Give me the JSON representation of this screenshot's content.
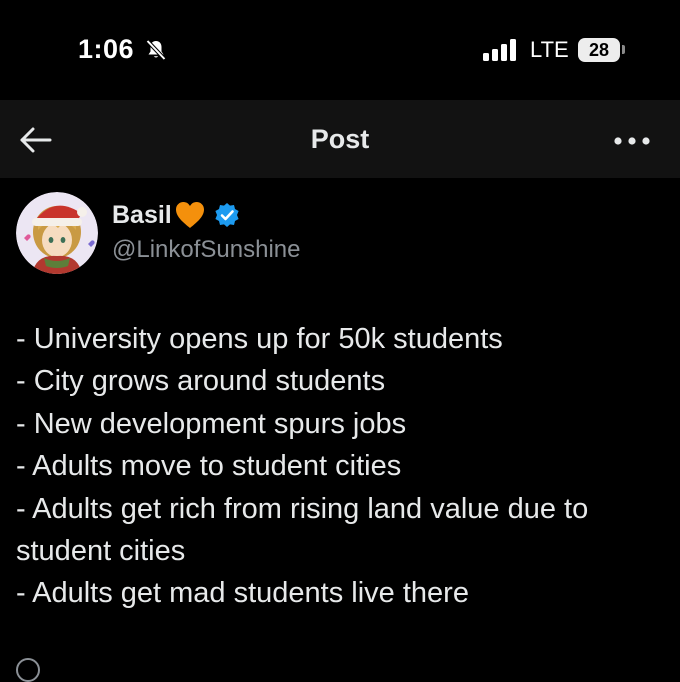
{
  "status_bar": {
    "time": "1:06",
    "network": "LTE",
    "battery": "28"
  },
  "nav": {
    "title": "Post"
  },
  "post": {
    "author_name": "Basil",
    "author_handle": "@LinkofSunshine",
    "lines": [
      "- University opens up for 50k students",
      "- City grows around students",
      "- New development spurs jobs",
      "- Adults move to student cities",
      "- Adults get rich from rising land value due to student cities",
      "- Adults get mad students live there"
    ]
  },
  "colors": {
    "background": "#000000",
    "nav_background": "#121212",
    "text": "#e7e9ea",
    "secondary_text": "#8b9096",
    "verified_blue": "#1d9bf0",
    "heart_orange": "#f4900c"
  },
  "icons": {
    "bell": "bell-slash-icon",
    "signal": "cellular-signal-icon",
    "back": "arrow-left-icon",
    "more": "more-horizontal-icon",
    "heart": "orange-heart-icon",
    "verified": "verified-badge-icon"
  }
}
